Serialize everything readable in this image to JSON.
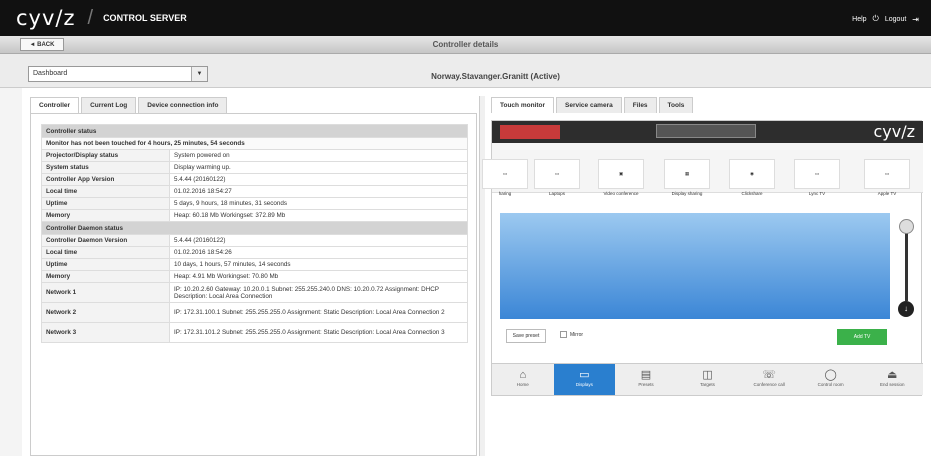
{
  "header": {
    "brand": "cyv/z",
    "title": "CONTROL SERVER",
    "help": "Help",
    "logout": "Logout"
  },
  "subheader": {
    "back": "◄ BACK",
    "title": "Controller details"
  },
  "toolbar": {
    "select_value": "Dashboard",
    "controller_name": "Norway.Stavanger.Granitt (Active)"
  },
  "left_tabs": [
    "Controller",
    "Current Log",
    "Device connection info"
  ],
  "right_tabs": [
    "Touch monitor",
    "Service camera",
    "Files",
    "Tools"
  ],
  "status_table": [
    {
      "type": "section",
      "label": "Controller status"
    },
    {
      "type": "note",
      "label": "Monitor has not been touched for 4 hours, 25 minutes, 54 seconds"
    },
    {
      "type": "row",
      "key": "Projector/Display status",
      "value": "System powered on"
    },
    {
      "type": "row",
      "key": "System status",
      "value": "Display warming up."
    },
    {
      "type": "row",
      "key": "Controller App Version",
      "value": "5.4.44 (20160122)"
    },
    {
      "type": "row",
      "key": "Local time",
      "value": "01.02.2016 18:54:27"
    },
    {
      "type": "row",
      "key": "Uptime",
      "value": "5 days, 9 hours, 18 minutes, 31 seconds"
    },
    {
      "type": "row",
      "key": "Memory",
      "value": "Heap: 60.18 Mb   Workingset: 372.89 Mb"
    },
    {
      "type": "section",
      "label": "Controller Daemon status"
    },
    {
      "type": "row",
      "key": "Controller Daemon Version",
      "value": "5.4.44 (20160122)"
    },
    {
      "type": "row",
      "key": "Local time",
      "value": "01.02.2016 18:54:26"
    },
    {
      "type": "row",
      "key": "Uptime",
      "value": "10 days, 1 hours, 57 minutes, 14 seconds"
    },
    {
      "type": "row",
      "key": "Memory",
      "value": "Heap: 4.91 Mb   Workingset: 70.80 Mb"
    },
    {
      "type": "tall",
      "key": "Network 1",
      "value": "IP: 10.20.2.60 Gateway: 10.20.0.1 Subnet: 255.255.240.0 DNS: 10.20.0.72 Assignment: DHCP Description: Local Area Connection"
    },
    {
      "type": "tall",
      "key": "Network 2",
      "value": "IP: 172.31.100.1 Subnet: 255.255.255.0 Assignment: Static Description: Local Area Connection 2"
    },
    {
      "type": "tall",
      "key": "Network 3",
      "value": "IP: 172.31.101.2 Subnet: 255.255.255.0 Assignment: Static Description: Local Area Connection 3"
    }
  ],
  "touch_monitor": {
    "brand": "cyv/z",
    "sources": [
      "haring",
      "Laptops",
      "Video conference",
      "Display sharing",
      "Clickshare",
      "Lync TV",
      "Apple TV"
    ],
    "save_preset": "Save preset",
    "mirror": "Mirror",
    "add": "Add TV",
    "nav": [
      {
        "label": "Home",
        "icon": "⌂"
      },
      {
        "label": "Displays",
        "icon": "▭"
      },
      {
        "label": "Presets",
        "icon": "▤"
      },
      {
        "label": "Targets",
        "icon": "◫"
      },
      {
        "label": "Conference call",
        "icon": "☏"
      },
      {
        "label": "Control room",
        "icon": "◯"
      },
      {
        "label": "End session",
        "icon": "⏏"
      }
    ]
  }
}
